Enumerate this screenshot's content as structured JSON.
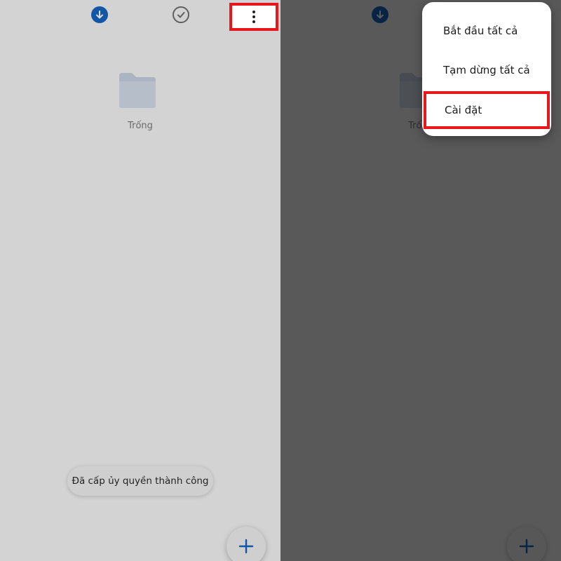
{
  "colors": {
    "accent": "#1565c0",
    "highlight": "#e8171b"
  },
  "tabs": {
    "download_icon": "download-circle-icon",
    "completed_icon": "check-circle-icon"
  },
  "toolbar": {
    "more_icon": "more-vert-icon"
  },
  "empty_state": {
    "icon": "folder-icon",
    "label": "Trống"
  },
  "toast": {
    "message": "Đã cấp ủy quyền thành công"
  },
  "fab": {
    "icon": "plus-icon"
  },
  "menu": {
    "items": [
      {
        "label": "Bắt đầu tất cả"
      },
      {
        "label": "Tạm dừng tất cả"
      },
      {
        "label": "Cài đặt"
      }
    ]
  }
}
